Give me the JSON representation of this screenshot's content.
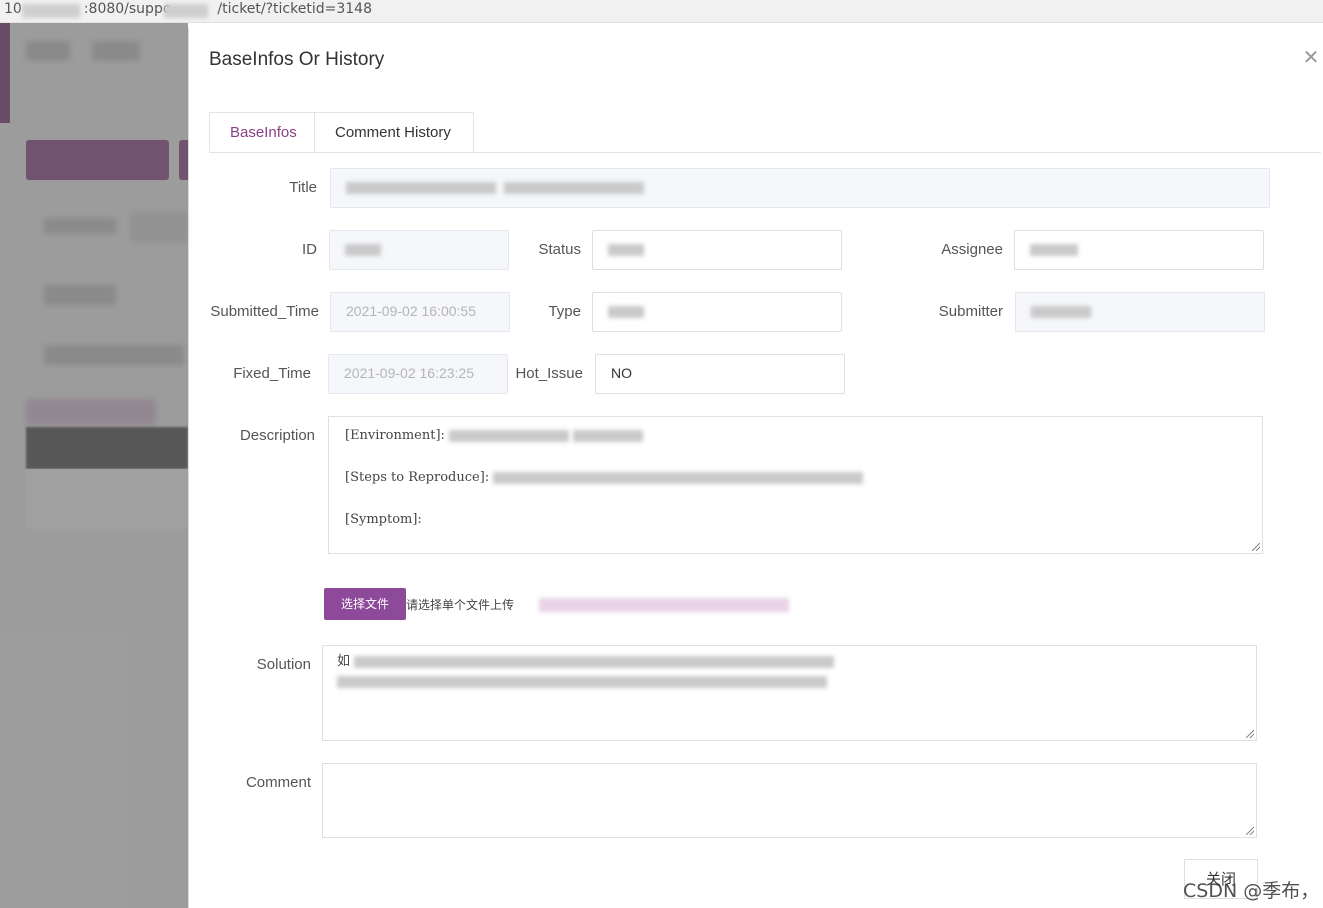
{
  "browser": {
    "url_prefix": "10",
    "url_part2": ":8080/suppo",
    "url_part3": "/ticket/?ticketid=3148"
  },
  "dialog": {
    "title": "BaseInfos Or History",
    "close_icon": "close-icon",
    "tabs": [
      {
        "label": "BaseInfos",
        "active": true
      },
      {
        "label": "Comment History",
        "active": false
      }
    ],
    "fields": {
      "title_label": "Title",
      "id_label": "ID",
      "status_label": "Status",
      "assignee_label": "Assignee",
      "submitted_time_label": "Submitted_Time",
      "submitted_time_value": "2021-09-02 16:00:55",
      "type_label": "Type",
      "submitter_label": "Submitter",
      "fixed_time_label": "Fixed_Time",
      "fixed_time_value": "2021-09-02 16:23:25",
      "hot_issue_label": "Hot_Issue",
      "hot_issue_value": "NO",
      "description_label": "Description",
      "description_lines": [
        "[Environment]:",
        "[Steps to Reproduce]:",
        "[Symptom]:"
      ],
      "solution_label": "Solution",
      "solution_prefix": "如",
      "comment_label": "Comment"
    },
    "upload": {
      "button_label": "选择文件",
      "hint": "请选择单个文件上传"
    },
    "footer": {
      "close_button_label": "关闭"
    }
  },
  "watermark": "CSDN @季布，",
  "colors": {
    "accent": "#8a3f86",
    "upload_button": "#8e4a9a"
  }
}
